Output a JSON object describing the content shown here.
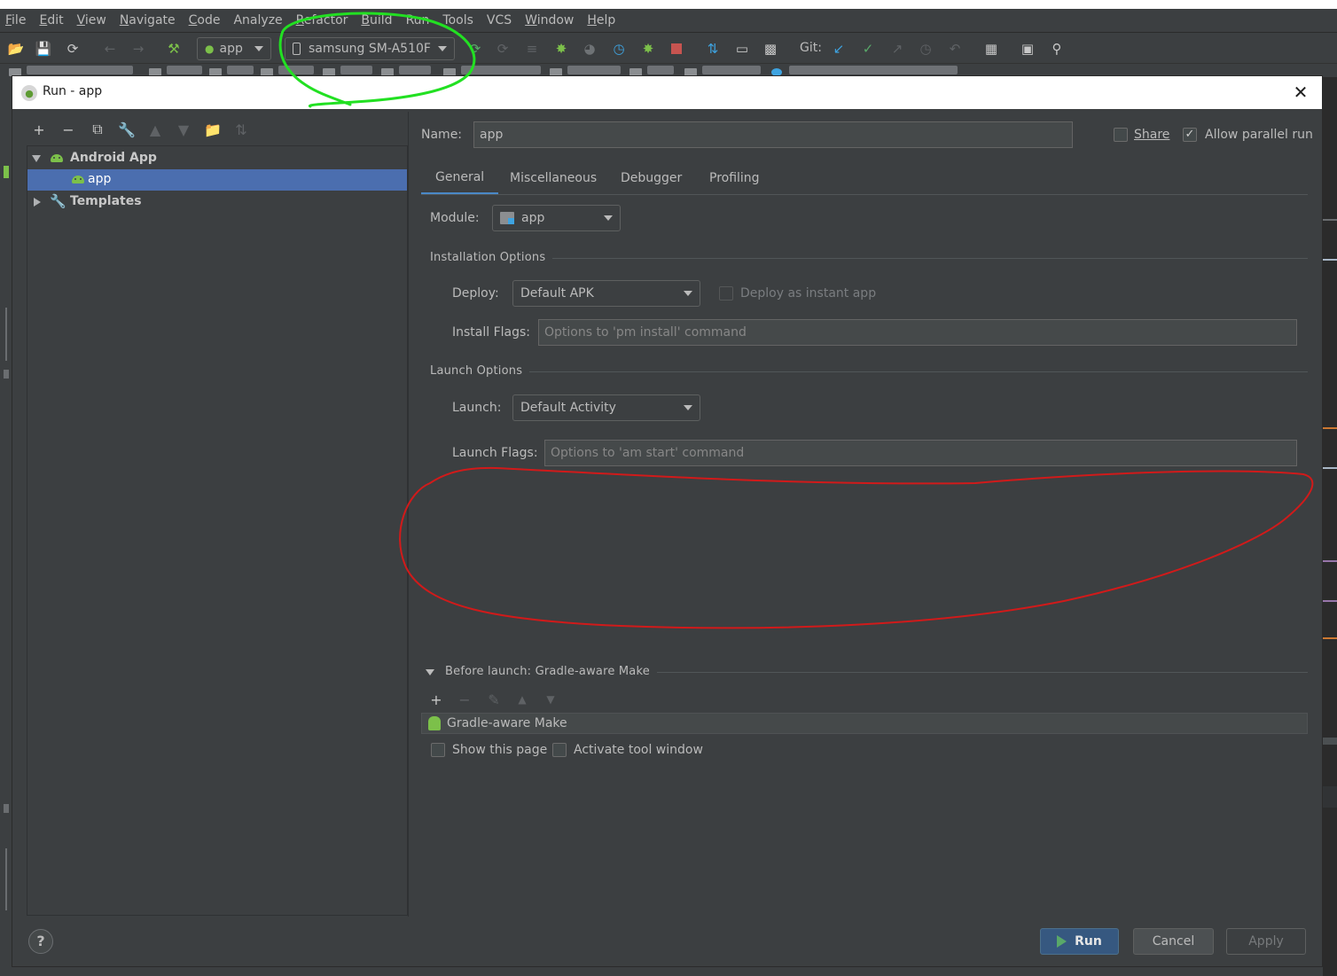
{
  "menubar": {
    "items": [
      {
        "mnemonic": "F",
        "rest": "ile"
      },
      {
        "mnemonic": "E",
        "rest": "dit"
      },
      {
        "mnemonic": "V",
        "rest": "iew"
      },
      {
        "mnemonic": "N",
        "rest": "avigate"
      },
      {
        "mnemonic": "C",
        "rest": "ode"
      },
      {
        "mnemonic": "",
        "rest": "Analyze"
      },
      {
        "mnemonic": "R",
        "rest": "efactor"
      },
      {
        "mnemonic": "B",
        "rest": "uild"
      },
      {
        "mnemonic": "",
        "rest": "Run"
      },
      {
        "mnemonic": "",
        "rest": "Tools"
      },
      {
        "mnemonic": "",
        "rest": "VCS"
      },
      {
        "mnemonic": "W",
        "rest": "indow"
      },
      {
        "mnemonic": "H",
        "rest": "elp"
      }
    ]
  },
  "toolbar": {
    "config_combo": "app",
    "device_combo": "samsung SM-A510F",
    "git_label": "Git:"
  },
  "dialog": {
    "title": "Run - app",
    "close_symbol": "✕",
    "tree": {
      "android_app": "Android App",
      "app": "app",
      "templates": "Templates"
    },
    "name_label": "Name:",
    "name_value": "app",
    "share_label": "Share",
    "allow_parallel_label": "Allow parallel run",
    "allow_parallel_checked": true,
    "tabs": [
      "General",
      "Miscellaneous",
      "Debugger",
      "Profiling"
    ],
    "module_label": "Module:",
    "module_value": "app",
    "installation_options": "Installation Options",
    "deploy_label": "Deploy:",
    "deploy_value": "Default APK",
    "deploy_instant_label": "Deploy as instant app",
    "install_flags_label": "Install Flags:",
    "install_flags_placeholder": "Options to 'pm install' command",
    "launch_options": "Launch Options",
    "launch_label": "Launch:",
    "launch_value": "Default Activity",
    "launch_flags_label": "Launch Flags:",
    "launch_flags_placeholder": "Options to 'am start' command",
    "before_launch": "Before launch: Gradle-aware Make",
    "gradle_task": "Gradle-aware Make",
    "show_page_label": "Show this page",
    "activate_tool_label": "Activate tool window",
    "help_symbol": "?",
    "run_button": "Run",
    "cancel_button": "Cancel",
    "apply_button": "Apply"
  },
  "colors": {
    "accent_selection": "#4b6eaf",
    "annotation_green": "#22e022",
    "annotation_red": "#d11a1a",
    "run_green": "#59a869"
  }
}
